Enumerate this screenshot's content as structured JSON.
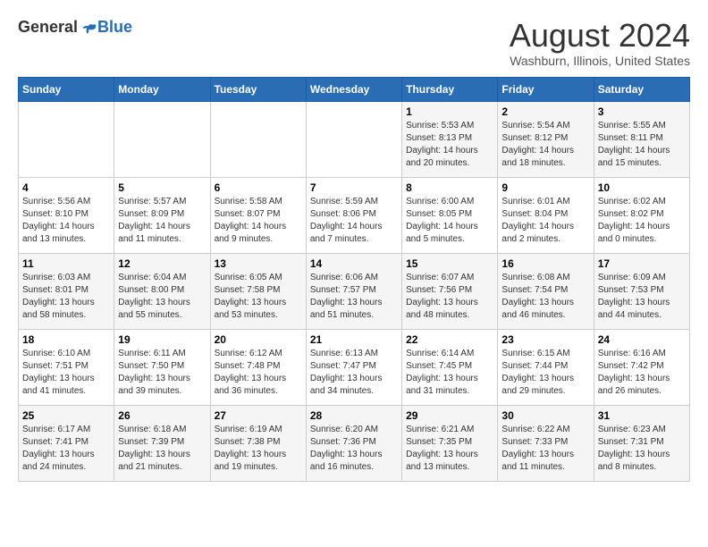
{
  "header": {
    "logo_general": "General",
    "logo_blue": "Blue",
    "month_title": "August 2024",
    "location": "Washburn, Illinois, United States"
  },
  "days_of_week": [
    "Sunday",
    "Monday",
    "Tuesday",
    "Wednesday",
    "Thursday",
    "Friday",
    "Saturday"
  ],
  "weeks": [
    [
      {
        "day": "",
        "info": ""
      },
      {
        "day": "",
        "info": ""
      },
      {
        "day": "",
        "info": ""
      },
      {
        "day": "",
        "info": ""
      },
      {
        "day": "1",
        "info": "Sunrise: 5:53 AM\nSunset: 8:13 PM\nDaylight: 14 hours\nand 20 minutes."
      },
      {
        "day": "2",
        "info": "Sunrise: 5:54 AM\nSunset: 8:12 PM\nDaylight: 14 hours\nand 18 minutes."
      },
      {
        "day": "3",
        "info": "Sunrise: 5:55 AM\nSunset: 8:11 PM\nDaylight: 14 hours\nand 15 minutes."
      }
    ],
    [
      {
        "day": "4",
        "info": "Sunrise: 5:56 AM\nSunset: 8:10 PM\nDaylight: 14 hours\nand 13 minutes."
      },
      {
        "day": "5",
        "info": "Sunrise: 5:57 AM\nSunset: 8:09 PM\nDaylight: 14 hours\nand 11 minutes."
      },
      {
        "day": "6",
        "info": "Sunrise: 5:58 AM\nSunset: 8:07 PM\nDaylight: 14 hours\nand 9 minutes."
      },
      {
        "day": "7",
        "info": "Sunrise: 5:59 AM\nSunset: 8:06 PM\nDaylight: 14 hours\nand 7 minutes."
      },
      {
        "day": "8",
        "info": "Sunrise: 6:00 AM\nSunset: 8:05 PM\nDaylight: 14 hours\nand 5 minutes."
      },
      {
        "day": "9",
        "info": "Sunrise: 6:01 AM\nSunset: 8:04 PM\nDaylight: 14 hours\nand 2 minutes."
      },
      {
        "day": "10",
        "info": "Sunrise: 6:02 AM\nSunset: 8:02 PM\nDaylight: 14 hours\nand 0 minutes."
      }
    ],
    [
      {
        "day": "11",
        "info": "Sunrise: 6:03 AM\nSunset: 8:01 PM\nDaylight: 13 hours\nand 58 minutes."
      },
      {
        "day": "12",
        "info": "Sunrise: 6:04 AM\nSunset: 8:00 PM\nDaylight: 13 hours\nand 55 minutes."
      },
      {
        "day": "13",
        "info": "Sunrise: 6:05 AM\nSunset: 7:58 PM\nDaylight: 13 hours\nand 53 minutes."
      },
      {
        "day": "14",
        "info": "Sunrise: 6:06 AM\nSunset: 7:57 PM\nDaylight: 13 hours\nand 51 minutes."
      },
      {
        "day": "15",
        "info": "Sunrise: 6:07 AM\nSunset: 7:56 PM\nDaylight: 13 hours\nand 48 minutes."
      },
      {
        "day": "16",
        "info": "Sunrise: 6:08 AM\nSunset: 7:54 PM\nDaylight: 13 hours\nand 46 minutes."
      },
      {
        "day": "17",
        "info": "Sunrise: 6:09 AM\nSunset: 7:53 PM\nDaylight: 13 hours\nand 44 minutes."
      }
    ],
    [
      {
        "day": "18",
        "info": "Sunrise: 6:10 AM\nSunset: 7:51 PM\nDaylight: 13 hours\nand 41 minutes."
      },
      {
        "day": "19",
        "info": "Sunrise: 6:11 AM\nSunset: 7:50 PM\nDaylight: 13 hours\nand 39 minutes."
      },
      {
        "day": "20",
        "info": "Sunrise: 6:12 AM\nSunset: 7:48 PM\nDaylight: 13 hours\nand 36 minutes."
      },
      {
        "day": "21",
        "info": "Sunrise: 6:13 AM\nSunset: 7:47 PM\nDaylight: 13 hours\nand 34 minutes."
      },
      {
        "day": "22",
        "info": "Sunrise: 6:14 AM\nSunset: 7:45 PM\nDaylight: 13 hours\nand 31 minutes."
      },
      {
        "day": "23",
        "info": "Sunrise: 6:15 AM\nSunset: 7:44 PM\nDaylight: 13 hours\nand 29 minutes."
      },
      {
        "day": "24",
        "info": "Sunrise: 6:16 AM\nSunset: 7:42 PM\nDaylight: 13 hours\nand 26 minutes."
      }
    ],
    [
      {
        "day": "25",
        "info": "Sunrise: 6:17 AM\nSunset: 7:41 PM\nDaylight: 13 hours\nand 24 minutes."
      },
      {
        "day": "26",
        "info": "Sunrise: 6:18 AM\nSunset: 7:39 PM\nDaylight: 13 hours\nand 21 minutes."
      },
      {
        "day": "27",
        "info": "Sunrise: 6:19 AM\nSunset: 7:38 PM\nDaylight: 13 hours\nand 19 minutes."
      },
      {
        "day": "28",
        "info": "Sunrise: 6:20 AM\nSunset: 7:36 PM\nDaylight: 13 hours\nand 16 minutes."
      },
      {
        "day": "29",
        "info": "Sunrise: 6:21 AM\nSunset: 7:35 PM\nDaylight: 13 hours\nand 13 minutes."
      },
      {
        "day": "30",
        "info": "Sunrise: 6:22 AM\nSunset: 7:33 PM\nDaylight: 13 hours\nand 11 minutes."
      },
      {
        "day": "31",
        "info": "Sunrise: 6:23 AM\nSunset: 7:31 PM\nDaylight: 13 hours\nand 8 minutes."
      }
    ]
  ]
}
